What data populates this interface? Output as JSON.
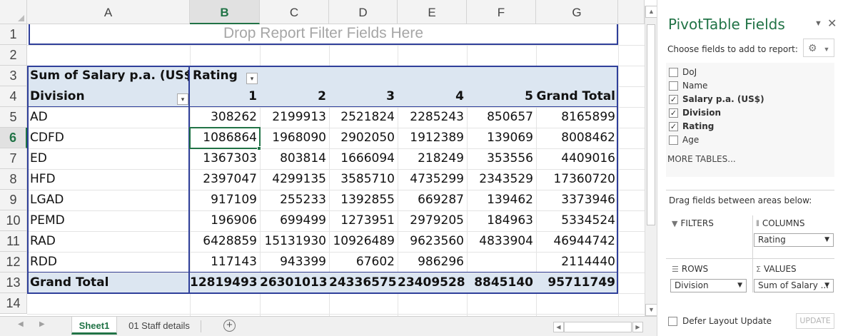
{
  "columns": [
    "A",
    "B",
    "C",
    "D",
    "E",
    "F",
    "G"
  ],
  "rows": [
    "1",
    "2",
    "3",
    "4",
    "5",
    "6",
    "7",
    "8",
    "9",
    "10",
    "11",
    "12",
    "13",
    "14"
  ],
  "selected_column": "B",
  "selected_row": "6",
  "filter_drop_text": "Drop Report Filter Fields Here",
  "pivot": {
    "sum_label": "Sum of Salary p.a. (US$)",
    "column_field": "Rating",
    "row_field": "Division",
    "col_labels": [
      "1",
      "2",
      "3",
      "4",
      "5",
      "Grand Total"
    ],
    "data_rows": [
      {
        "label": "AD",
        "values": [
          "308262",
          "2199913",
          "2521824",
          "2285243",
          "850657",
          "8165899"
        ]
      },
      {
        "label": "CDFD",
        "values": [
          "1086864",
          "1968090",
          "2902050",
          "1912389",
          "139069",
          "8008462"
        ]
      },
      {
        "label": "ED",
        "values": [
          "1367303",
          "803814",
          "1666094",
          "218249",
          "353556",
          "4409016"
        ]
      },
      {
        "label": "HFD",
        "values": [
          "2397047",
          "4299135",
          "3585710",
          "4735299",
          "2343529",
          "17360720"
        ]
      },
      {
        "label": "LGAD",
        "values": [
          "917109",
          "255233",
          "1392855",
          "669287",
          "139462",
          "3373946"
        ]
      },
      {
        "label": "PEMD",
        "values": [
          "196906",
          "699499",
          "1273951",
          "2979205",
          "184963",
          "5334524"
        ]
      },
      {
        "label": "RAD",
        "values": [
          "6428859",
          "15131930",
          "10926489",
          "9623560",
          "4833904",
          "46944742"
        ]
      },
      {
        "label": "RDD",
        "values": [
          "117143",
          "943399",
          "67602",
          "986296",
          "",
          "2114440"
        ]
      }
    ],
    "grand_total": {
      "label": "Grand Total",
      "values": [
        "12819493",
        "26301013",
        "24336575",
        "23409528",
        "8845140",
        "95711749"
      ]
    }
  },
  "tabs": [
    {
      "label": "Sheet1",
      "active": true
    },
    {
      "label": "01 Staff details",
      "active": false
    }
  ],
  "pane": {
    "title": "PivotTable Fields",
    "subtitle": "Choose fields to add to report:",
    "fields": [
      {
        "label": "DoJ",
        "checked": false
      },
      {
        "label": "Name",
        "checked": false
      },
      {
        "label": "Salary p.a. (US$)",
        "checked": true
      },
      {
        "label": "Division",
        "checked": true
      },
      {
        "label": "Rating",
        "checked": true
      },
      {
        "label": "Age",
        "checked": false
      }
    ],
    "more_tables": "MORE TABLES...",
    "drag_hint": "Drag fields between areas below:",
    "areas": {
      "filters": {
        "title": "FILTERS"
      },
      "columns": {
        "title": "COLUMNS",
        "item": "Rating"
      },
      "rows": {
        "title": "ROWS",
        "item": "Division"
      },
      "values": {
        "title": "VALUES",
        "item": "Sum of Salary ..."
      }
    },
    "defer_label": "Defer Layout Update",
    "update_label": "UPDATE"
  },
  "colors": {
    "excel_green": "#217346",
    "pivot_border": "#2f3f9a",
    "pivot_band": "#dce6f1"
  },
  "icons": {
    "dropdown": "chevron-down-icon",
    "close": "close-icon",
    "gear": "gear-icon",
    "filter": "filter-icon",
    "columns": "columns-icon",
    "rows": "rows-icon",
    "values": "sigma-icon",
    "add_sheet": "plus-icon"
  }
}
